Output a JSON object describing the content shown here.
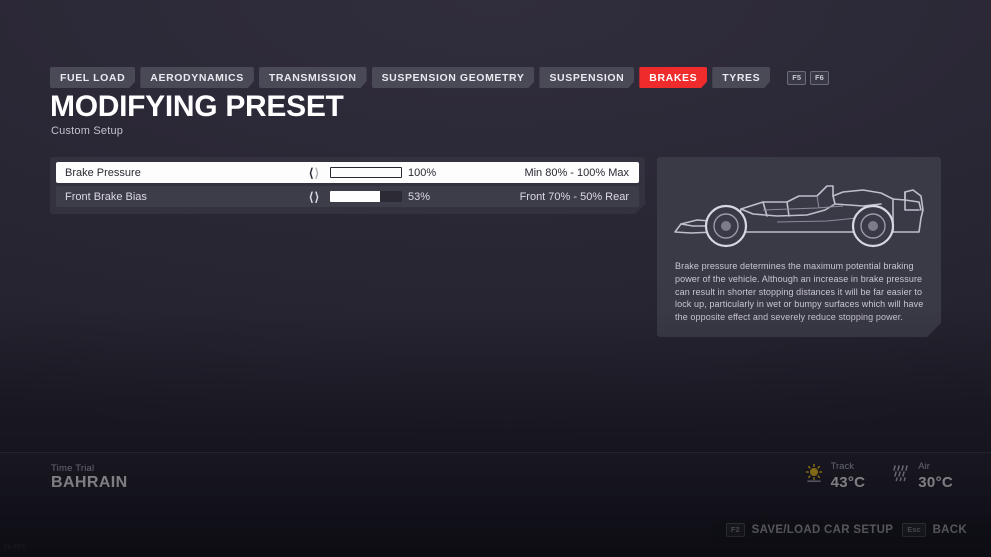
{
  "tabs": [
    {
      "label": "FUEL LOAD",
      "active": false
    },
    {
      "label": "AERODYNAMICS",
      "active": false
    },
    {
      "label": "TRANSMISSION",
      "active": false
    },
    {
      "label": "SUSPENSION GEOMETRY",
      "active": false
    },
    {
      "label": "SUSPENSION",
      "active": false
    },
    {
      "label": "BRAKES",
      "active": true
    },
    {
      "label": "TYRES",
      "active": false
    }
  ],
  "key_hints": [
    {
      "key": "F5"
    },
    {
      "key": "F6"
    }
  ],
  "header": {
    "title": "MODIFYING PRESET",
    "subtitle": "Custom Setup"
  },
  "settings": {
    "rows": [
      {
        "label": "Brake Pressure",
        "value": "100%",
        "fill_percent": 100,
        "range": "Min 80% - 100% Max",
        "selected": true,
        "left_arrow_enabled": true,
        "right_arrow_enabled": false
      },
      {
        "label": "Front Brake Bias",
        "value": "53%",
        "fill_percent": 70,
        "range": "Front 70% - 50% Rear",
        "selected": false,
        "left_arrow_enabled": true,
        "right_arrow_enabled": true
      }
    ]
  },
  "info": {
    "car_icon": "f1-car-side-outline",
    "description": "Brake pressure determines the maximum potential braking power of the vehicle. Although an increase in brake pressure can result in shorter stopping distances it will be far easier to lock up, particularly in wet or bumpy surfaces which will have the opposite effect and severely reduce stopping power."
  },
  "status": {
    "mode": "Time Trial",
    "track": "BAHRAIN",
    "weather": [
      {
        "icon": "sun-icon",
        "label": "Track",
        "value": "43°C"
      },
      {
        "icon": "rain-icon",
        "label": "Air",
        "value": "30°C"
      }
    ]
  },
  "prompts": [
    {
      "key": "F2",
      "label": "SAVE/LOAD CAR SETUP"
    },
    {
      "key": "Esc",
      "label": "BACK"
    }
  ],
  "overlay": {
    "fps": "58 FPS"
  },
  "colors": {
    "accent_red": "#ef2b2b",
    "sun_yellow": "#f5c518",
    "background": "#2a2835"
  }
}
